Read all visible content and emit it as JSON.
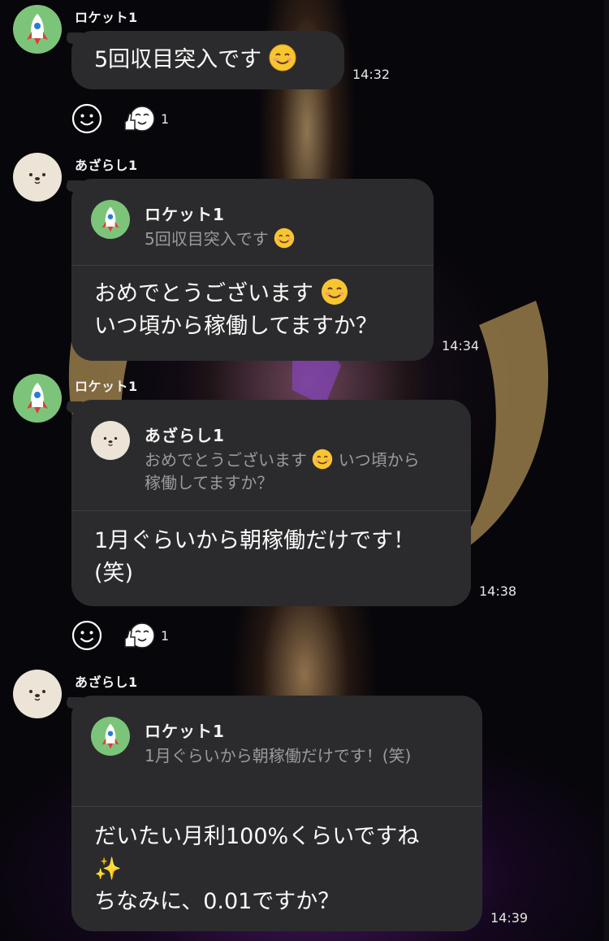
{
  "users": {
    "rocket": "ロケット1",
    "seal": "あざらし1"
  },
  "messages": [
    {
      "sender": "ロケット1",
      "text": "5回収目突入です",
      "emoji": "smiling-face",
      "time": "14:32",
      "reaction_count": "1"
    },
    {
      "sender": "あざらし1",
      "quote": {
        "name": "ロケット1",
        "text": "5回収目突入です"
      },
      "text_line1": "おめでとうございます",
      "text_line2": "いつ頃から稼働してますか？",
      "time": "14:34"
    },
    {
      "sender": "ロケット1",
      "quote": {
        "name": "あざらし1",
        "text_line1": "おめでとうございます",
        "text_line1b": " いつ頃から",
        "text_line2": "稼働してますか？"
      },
      "text_line1": "1月ぐらいから朝稼働だけです！",
      "text_line2": "(笑)",
      "time": "14:38",
      "reaction_count": "1"
    },
    {
      "sender": "あざらし1",
      "quote": {
        "name": "ロケット1",
        "text": "1月ぐらいから朝稼働だけです！(笑)"
      },
      "text_line1": "だいたい月利100%くらいですね",
      "text_line2": "✨",
      "text_line3": "ちなみに、0.01ですか？",
      "time": "14:39"
    }
  ],
  "colors": {
    "bubble": "#2b2b2d",
    "background": "#07060a",
    "rocket_avatar": "#7cc47a",
    "seal_avatar": "#ece4d6",
    "quote_text": "#9a9a9c"
  },
  "icons": {
    "rocket_avatar": "rocket-icon",
    "seal_avatar": "seal-face-icon",
    "add_reaction": "smiley-outline-icon",
    "reaction": "thumbs-up-face-icon"
  }
}
